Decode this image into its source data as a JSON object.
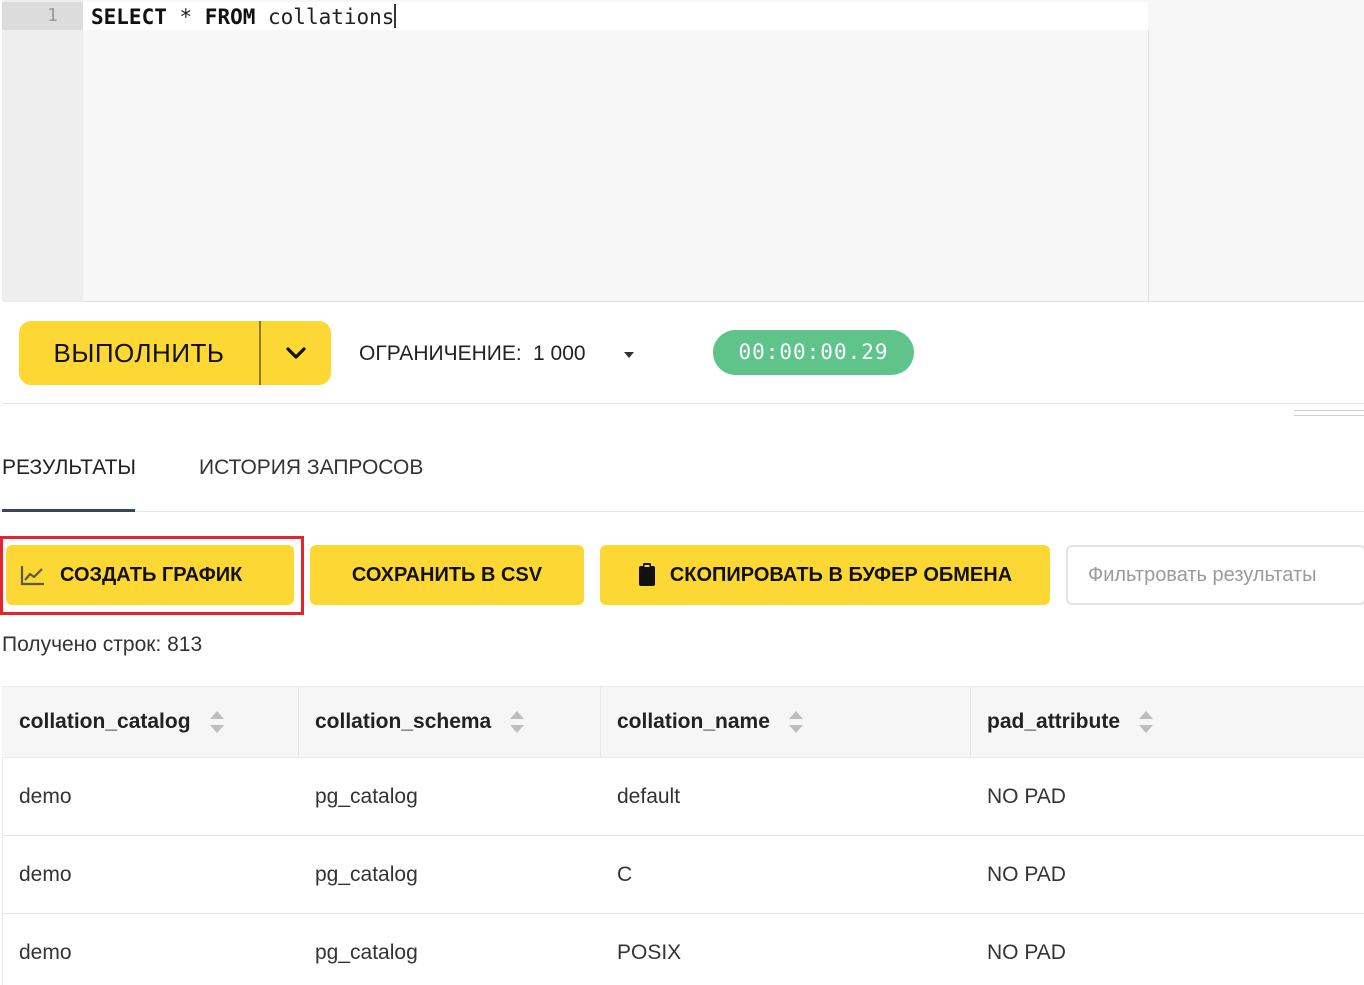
{
  "editor": {
    "line_number": "1",
    "sql": {
      "kw1": "SELECT",
      "star": " * ",
      "kw2": "FROM",
      "rest": " collations"
    }
  },
  "toolbar": {
    "run_label": "ВЫПОЛНИТЬ",
    "run_dropdown_icon": "chevron-down-icon",
    "limit_label": "ОГРАНИЧЕНИЕ:",
    "limit_value": "1 000",
    "timer": "00:00:00.29"
  },
  "tabs": [
    {
      "label": "РЕЗУЛЬТАТЫ",
      "active": true
    },
    {
      "label": "ИСТОРИЯ ЗАПРОСОВ",
      "active": false
    }
  ],
  "actions": {
    "create_chart": {
      "label": "СОЗДАТЬ ГРАФИК",
      "icon": "chart-line-icon"
    },
    "save_csv": {
      "label": "СОХРАНИТЬ В CSV"
    },
    "copy_clipboard": {
      "label": "СКОПИРОВАТЬ В БУФЕР ОБМЕНА",
      "icon": "clipboard-icon"
    },
    "filter_placeholder": "Фильтровать результаты"
  },
  "row_count_text": "Получено строк: 813",
  "table": {
    "columns": [
      "collation_catalog",
      "collation_schema",
      "collation_name",
      "pad_attribute"
    ],
    "rows": [
      [
        "demo",
        "pg_catalog",
        "default",
        "NO PAD"
      ],
      [
        "demo",
        "pg_catalog",
        "C",
        "NO PAD"
      ],
      [
        "demo",
        "pg_catalog",
        "POSIX",
        "NO PAD"
      ]
    ]
  },
  "colors": {
    "accent_yellow": "#fdd835",
    "timer_green": "#5ec48a",
    "highlight_red": "#e3262b",
    "tab_underline": "#3a4555"
  }
}
